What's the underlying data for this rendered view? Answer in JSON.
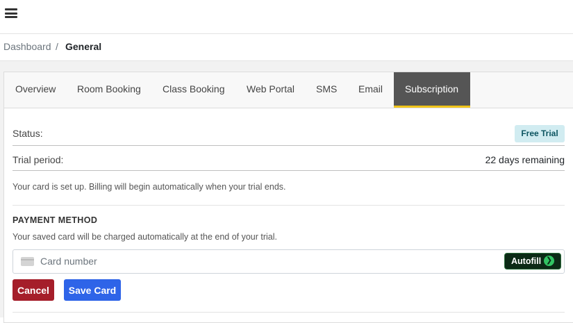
{
  "header": {
    "menu_icon": "hamburger-menu-icon"
  },
  "breadcrumb": {
    "parent": "Dashboard",
    "separator": "/",
    "current": "General"
  },
  "tabs": [
    {
      "label": "Overview"
    },
    {
      "label": "Room Booking"
    },
    {
      "label": "Class Booking"
    },
    {
      "label": "Web Portal"
    },
    {
      "label": "SMS"
    },
    {
      "label": "Email"
    },
    {
      "label": "Subscription",
      "active": true
    }
  ],
  "subscription": {
    "status_label": "Status:",
    "status_badge": "Free Trial",
    "trial_label": "Trial period:",
    "trial_value": "22 days remaining",
    "billing_note": "Your card is set up. Billing will begin automatically when your trial ends."
  },
  "payment": {
    "title": "PAYMENT METHOD",
    "description": "Your saved card will be charged automatically at the end of your trial.",
    "card_placeholder": "Card number",
    "card_icon": "credit-card-icon",
    "autofill_label": "Autofill",
    "autofill_icon": "arrow-right-circle-icon"
  },
  "actions": {
    "cancel": "Cancel",
    "save": "Save Card"
  },
  "colors": {
    "tab_active_bg": "#555555",
    "tab_active_underline": "#f0c419",
    "badge_bg": "#d1ecf1",
    "badge_text": "#0c5460",
    "cancel_bg": "#a51e2a",
    "save_bg": "#2e64e8",
    "autofill_bg": "#0c2a16",
    "autofill_arrow": "#32c463"
  }
}
